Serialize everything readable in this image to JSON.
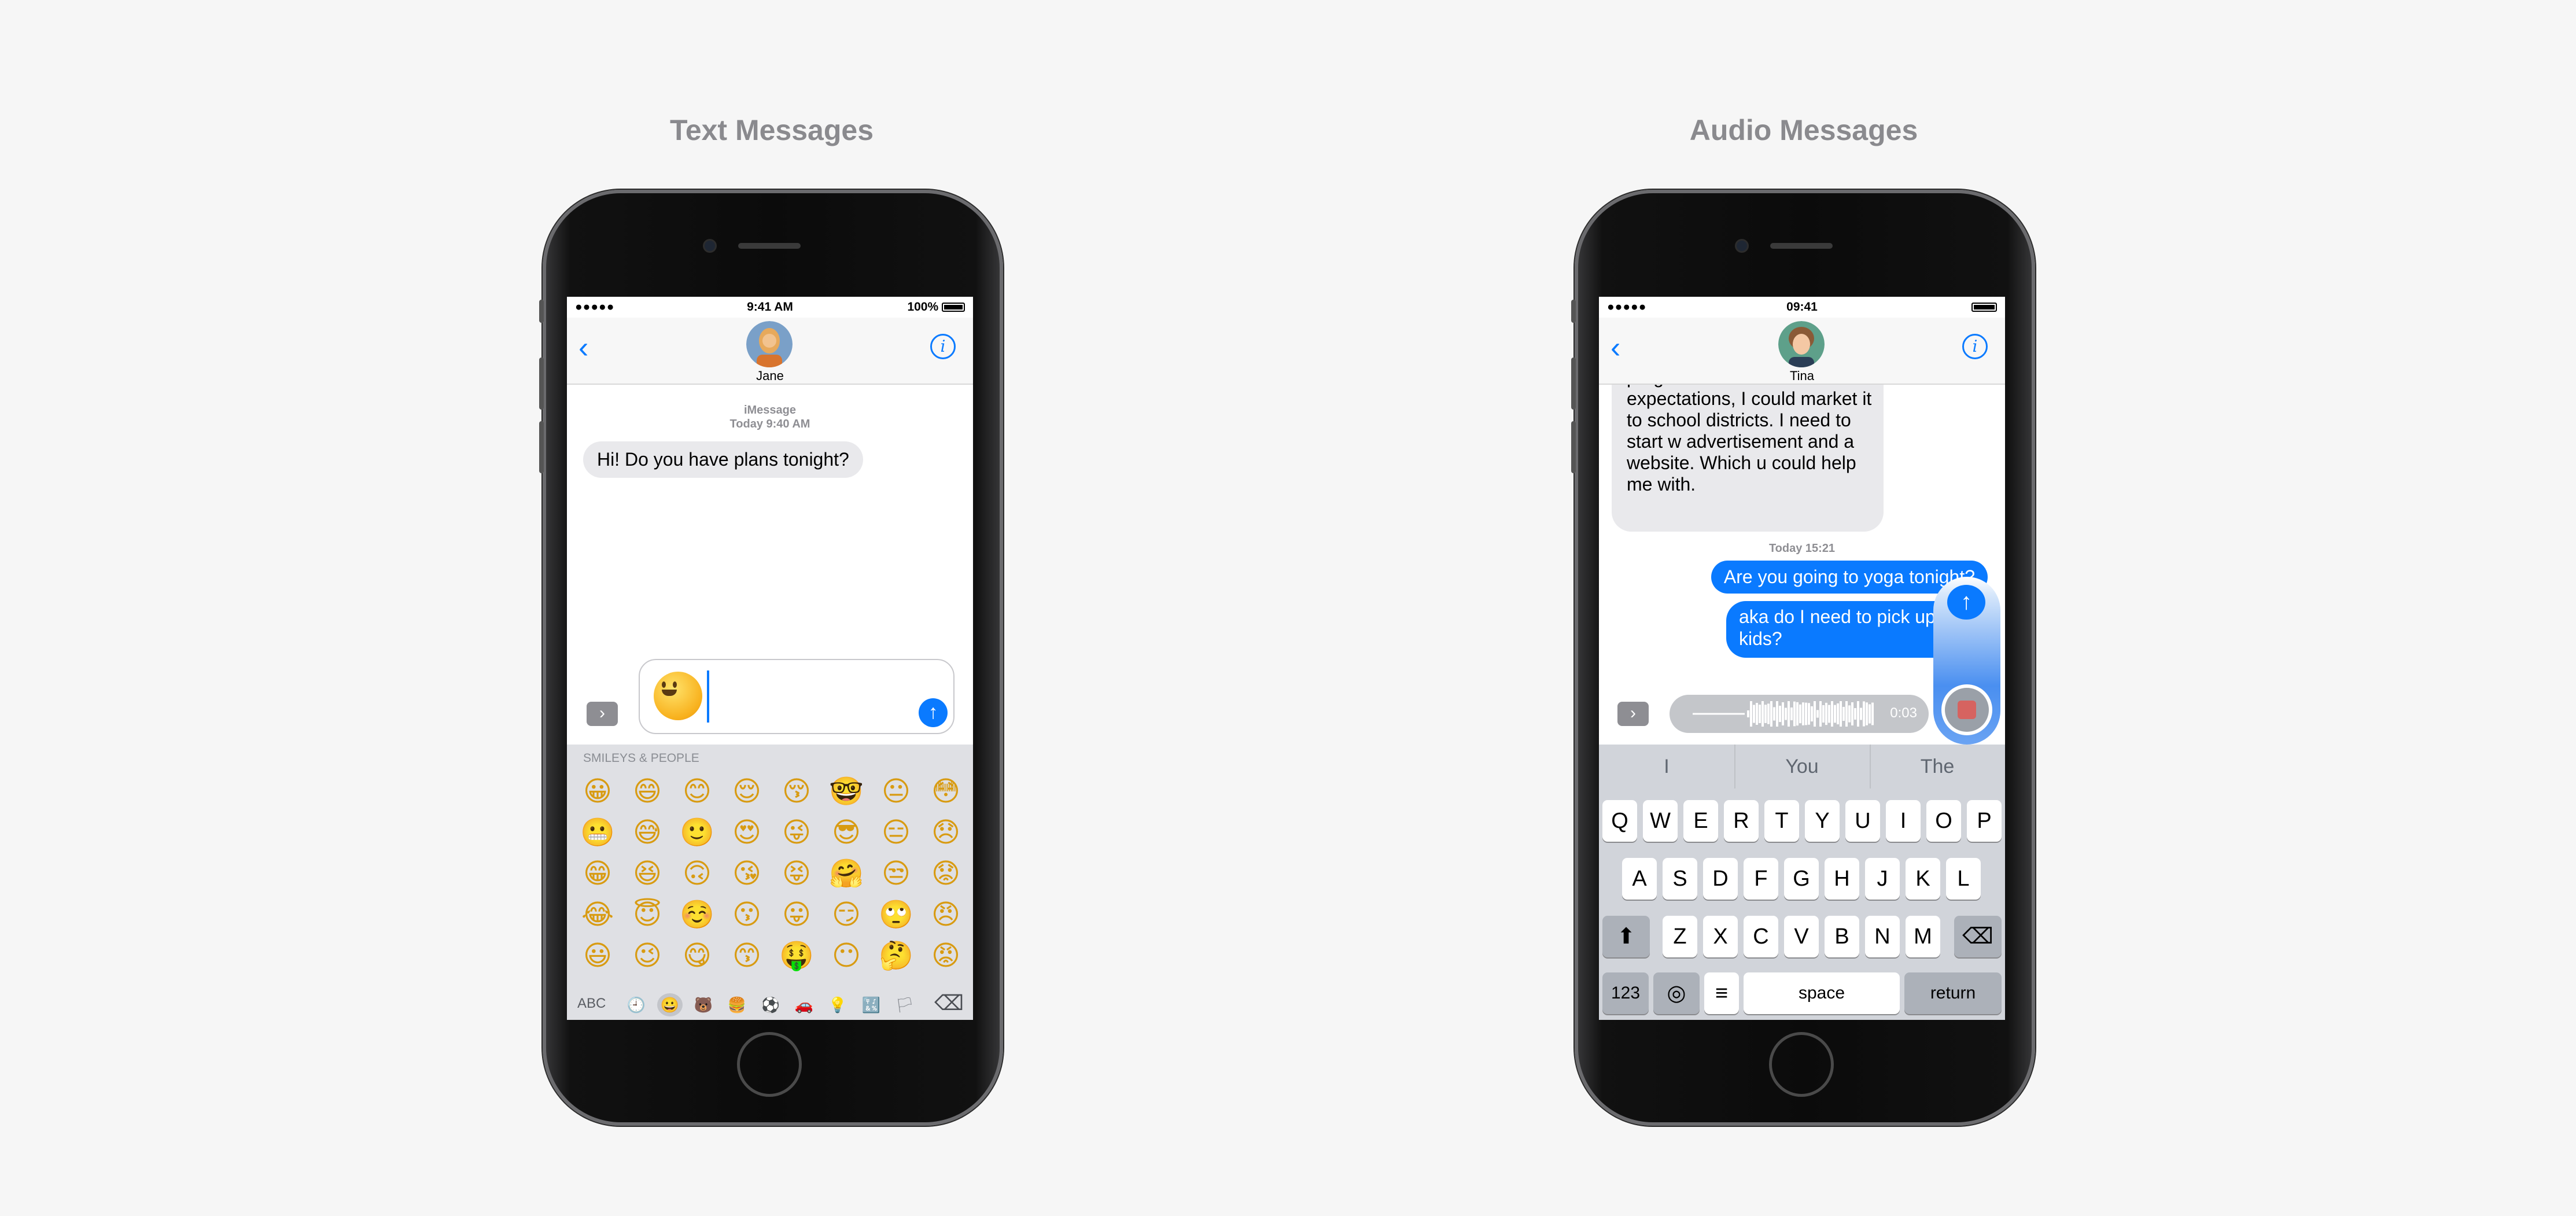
{
  "left_section": {
    "title": "Text Messages",
    "status": {
      "signal": "●●●●● ",
      "time": "9:41 AM",
      "battery_text": "100%"
    },
    "contact_name": "Jane",
    "meta_line1": "iMessage",
    "meta_line2": "Today 9:40 AM",
    "incoming_message": "Hi! Do you have plans tonight?",
    "emoji_category": "SMILEYS & PEOPLE",
    "emoji_rows": [
      [
        "😀",
        "😄",
        "😊",
        "😌",
        "😚",
        "🤓",
        "😐",
        "😳"
      ],
      [
        "😬",
        "😅",
        "🙂",
        "😍",
        "😜",
        "😎",
        "😑",
        "😞"
      ],
      [
        "😁",
        "😆",
        "🙃",
        "😘",
        "😝",
        "🤗",
        "😒",
        "😟"
      ],
      [
        "😂",
        "😇",
        "☺️",
        "😗",
        "😛",
        "😏",
        "🙄",
        "😠"
      ],
      [
        "😃",
        "😉",
        "😋",
        "😙",
        "🤑",
        "😶",
        "🤔",
        "😡"
      ]
    ],
    "keyboard_bottom": {
      "abc_label": "ABC",
      "category_icons": [
        "🕘",
        "😀",
        "🐻",
        "🍔",
        "⚽",
        "🚗",
        "💡",
        "🔣",
        "🏳"
      ],
      "delete_glyph": "⌫"
    },
    "compose_emoji": "😀"
  },
  "right_section": {
    "title": "Audio Messages",
    "status": {
      "signal": "●●●●● ",
      "time": "09:41"
    },
    "contact_name": "Tina",
    "incoming_lines": [
      "program that meets the states",
      "expectations, I could market it",
      "to school districts.  I need to",
      "start w advertisement and a",
      "website.  Which u could help",
      "me with."
    ],
    "timestamp": "Today 15:21",
    "outgoing_1": "Are you going to yoga tonight?",
    "outgoing_2_line1": "aka do I need to pick up",
    "outgoing_2_line2": "kids?",
    "recording_duration": "0:03",
    "predictions": [
      "I",
      "You",
      "The"
    ],
    "row1": [
      "Q",
      "W",
      "E",
      "R",
      "T",
      "Y",
      "U",
      "I",
      "O",
      "P"
    ],
    "row2": [
      "A",
      "S",
      "D",
      "F",
      "G",
      "H",
      "J",
      "K",
      "L"
    ],
    "row3": [
      "Z",
      "X",
      "C",
      "V",
      "B",
      "N",
      "M"
    ],
    "numbers_key": "123",
    "space_key": "space",
    "return_key": "return"
  },
  "colors": {
    "accent": "#0a7aff",
    "bubble_gray": "#e9e9ec",
    "keyboard_bg": "#d1d4da"
  }
}
